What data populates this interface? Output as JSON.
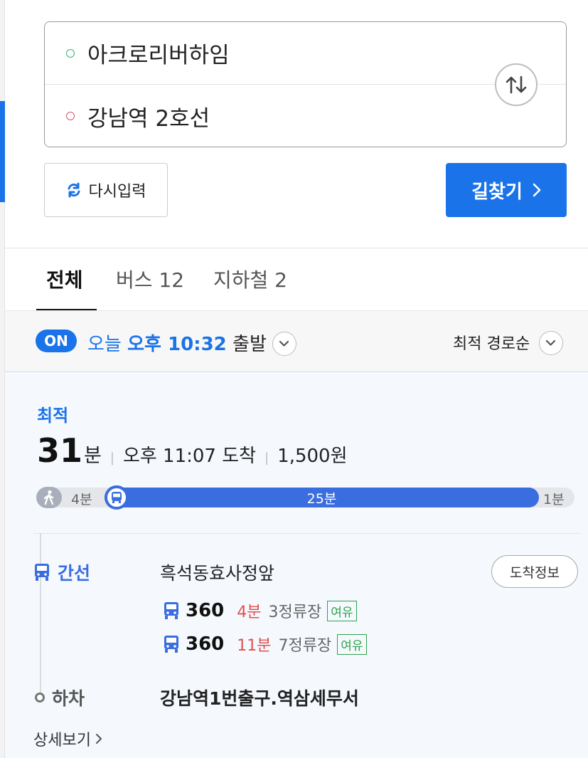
{
  "route": {
    "origin": "아크로리버하임",
    "destination": "강남역 2호선"
  },
  "buttons": {
    "reset": "다시입력",
    "search": "길찾기"
  },
  "tabs": [
    {
      "label": "전체",
      "active": true
    },
    {
      "label": "버스 12",
      "active": false
    },
    {
      "label": "지하철 2",
      "active": false
    }
  ],
  "depart": {
    "on_badge": "ON",
    "today": "오늘",
    "time": "오후 10:32",
    "suffix": "출발"
  },
  "sort": {
    "label": "최적 경로순"
  },
  "result": {
    "label": "최적",
    "duration": "31",
    "duration_unit": "분",
    "arrival": "오후 11:07 도착",
    "fare": "1,500원",
    "segments": {
      "walk_start": "4분",
      "bus": "25분",
      "walk_end": "1분"
    },
    "board": {
      "type_label": "간선",
      "stop": "흑석동효사정앞",
      "arrival_info_button": "도착정보",
      "buses": [
        {
          "number": "360",
          "minutes": "4분",
          "stops": "3정류장",
          "crowd": "여유"
        },
        {
          "number": "360",
          "minutes": "11분",
          "stops": "7정류장",
          "crowd": "여유"
        }
      ]
    },
    "alight": {
      "label": "하차",
      "stop": "강남역1번출구.역삼세무서"
    },
    "detail_link": "상세보기"
  },
  "colors": {
    "accent": "#1a73e8",
    "bus_blue": "#3a6ddf",
    "time_red": "#e05050",
    "crowd_green": "#2ea24a"
  }
}
